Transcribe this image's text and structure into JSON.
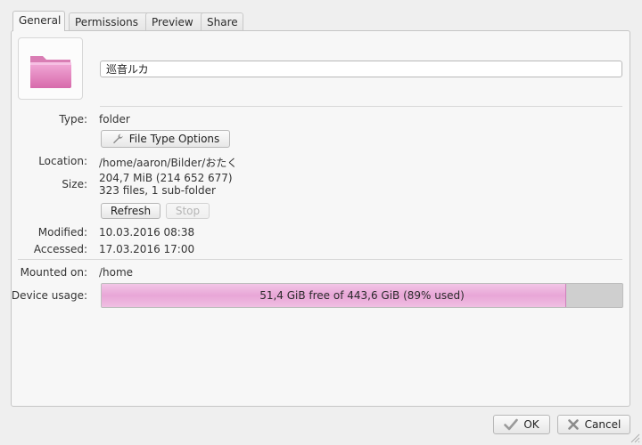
{
  "tabs": [
    {
      "label": "General",
      "active": true
    },
    {
      "label": "Permissions",
      "active": false
    },
    {
      "label": "Preview",
      "active": false
    },
    {
      "label": "Share",
      "active": false
    }
  ],
  "icon": {
    "name": "folder-icon",
    "color": "#e27fbf"
  },
  "name_field": {
    "value": "巡音ルカ"
  },
  "type": {
    "label": "Type:",
    "value": "folder"
  },
  "file_type_button": {
    "label": "File Type Options",
    "icon": "wrench-icon"
  },
  "location": {
    "label": "Location:",
    "value": "/home/aaron/Bilder/おたく"
  },
  "size": {
    "label": "Size:",
    "value": "204,7 MiB (214 652 677)",
    "detail": "323 files, 1 sub-folder"
  },
  "refresh_button": {
    "label": "Refresh"
  },
  "stop_button": {
    "label": "Stop",
    "disabled": true
  },
  "modified": {
    "label": "Modified:",
    "value": "10.03.2016 08:38"
  },
  "accessed": {
    "label": "Accessed:",
    "value": "17.03.2016 17:00"
  },
  "mounted_on": {
    "label": "Mounted on:",
    "value": "/home"
  },
  "device_usage": {
    "label": "Device usage:",
    "text": "51,4 GiB free of 443,6 GiB (89% used)",
    "used_fraction": 0.89
  },
  "ok_button": {
    "label": "OK",
    "icon": "check-icon"
  },
  "cancel_button": {
    "label": "Cancel",
    "icon": "x-icon"
  },
  "colors": {
    "accent": "#e8a6d7",
    "accent_border": "#cf7fbb"
  }
}
